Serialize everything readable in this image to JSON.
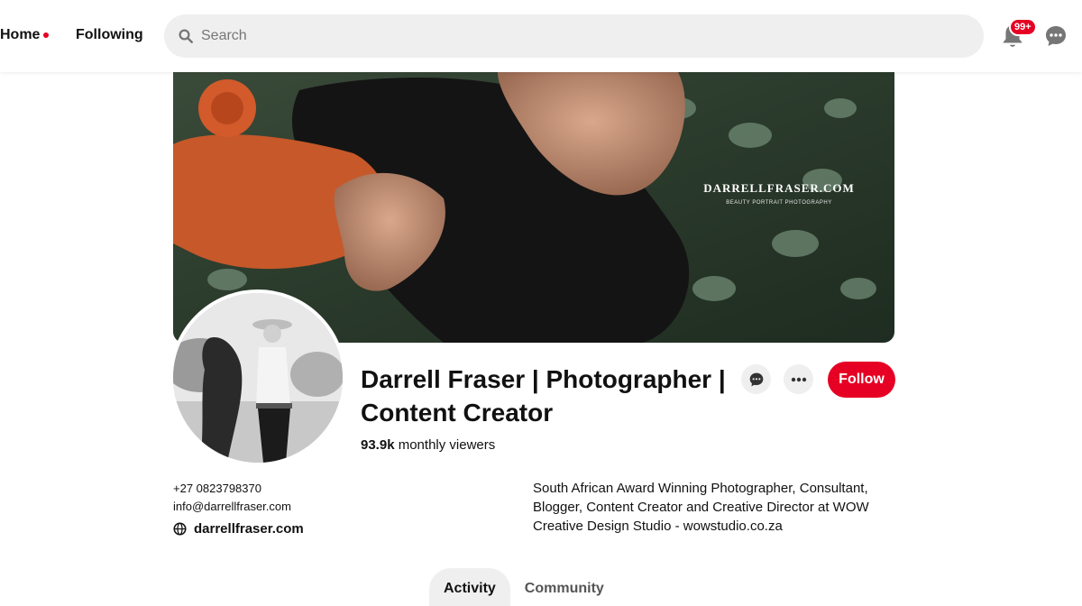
{
  "nav": {
    "home_label": "Home",
    "following_label": "Following"
  },
  "search": {
    "placeholder": "Search",
    "value": ""
  },
  "notifications": {
    "badge": "99+"
  },
  "profile": {
    "cover_watermark": "DARRELLFRASER.COM",
    "cover_watermark_sub": "BEAUTY PORTRAIT PHOTOGRAPHY",
    "name_line1": "Darrell Fraser | Photographer |",
    "name_line2": "Content Creator",
    "monthly_viewers_count": "93.9k",
    "monthly_viewers_label": "monthly viewers",
    "follow_label": "Follow",
    "phone": "+27 0823798370",
    "email": "info@darrellfraser.com",
    "website": "darrellfraser.com",
    "bio": "South African Award Winning Photographer, Consultant, Blogger, Content Creator and Creative Director at WOW Creative Design Studio - wowstudio.co.za"
  },
  "tabs": [
    {
      "label": "Activity",
      "active": true
    },
    {
      "label": "Community",
      "active": false
    }
  ],
  "colors": {
    "brand_red": "#e60023",
    "search_bg": "#efefef"
  },
  "icons": {
    "search": "search-icon",
    "bell": "bell-icon",
    "messages": "chat-bubble-icon",
    "website": "globe-icon",
    "more": "ellipsis-icon"
  }
}
